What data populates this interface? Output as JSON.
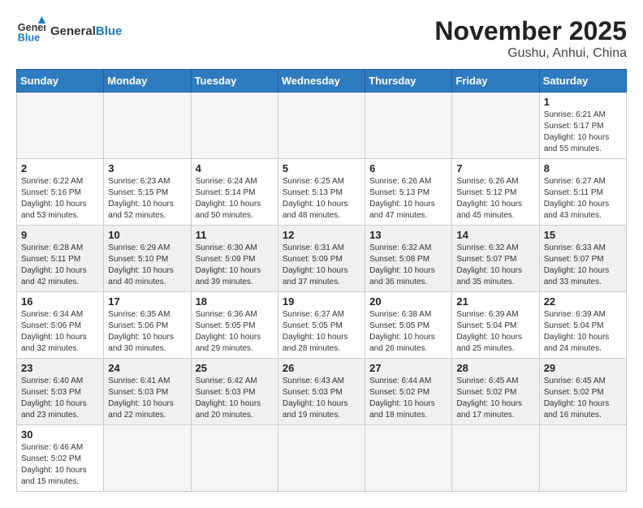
{
  "header": {
    "logo_general": "General",
    "logo_blue": "Blue",
    "month_title": "November 2025",
    "location": "Gushu, Anhui, China"
  },
  "weekdays": [
    "Sunday",
    "Monday",
    "Tuesday",
    "Wednesday",
    "Thursday",
    "Friday",
    "Saturday"
  ],
  "days": {
    "1": {
      "sunrise": "6:21 AM",
      "sunset": "5:17 PM",
      "daylight": "10 hours and 55 minutes."
    },
    "2": {
      "sunrise": "6:22 AM",
      "sunset": "5:16 PM",
      "daylight": "10 hours and 53 minutes."
    },
    "3": {
      "sunrise": "6:23 AM",
      "sunset": "5:15 PM",
      "daylight": "10 hours and 52 minutes."
    },
    "4": {
      "sunrise": "6:24 AM",
      "sunset": "5:14 PM",
      "daylight": "10 hours and 50 minutes."
    },
    "5": {
      "sunrise": "6:25 AM",
      "sunset": "5:13 PM",
      "daylight": "10 hours and 48 minutes."
    },
    "6": {
      "sunrise": "6:26 AM",
      "sunset": "5:13 PM",
      "daylight": "10 hours and 47 minutes."
    },
    "7": {
      "sunrise": "6:26 AM",
      "sunset": "5:12 PM",
      "daylight": "10 hours and 45 minutes."
    },
    "8": {
      "sunrise": "6:27 AM",
      "sunset": "5:11 PM",
      "daylight": "10 hours and 43 minutes."
    },
    "9": {
      "sunrise": "6:28 AM",
      "sunset": "5:11 PM",
      "daylight": "10 hours and 42 minutes."
    },
    "10": {
      "sunrise": "6:29 AM",
      "sunset": "5:10 PM",
      "daylight": "10 hours and 40 minutes."
    },
    "11": {
      "sunrise": "6:30 AM",
      "sunset": "5:09 PM",
      "daylight": "10 hours and 39 minutes."
    },
    "12": {
      "sunrise": "6:31 AM",
      "sunset": "5:09 PM",
      "daylight": "10 hours and 37 minutes."
    },
    "13": {
      "sunrise": "6:32 AM",
      "sunset": "5:08 PM",
      "daylight": "10 hours and 36 minutes."
    },
    "14": {
      "sunrise": "6:32 AM",
      "sunset": "5:07 PM",
      "daylight": "10 hours and 35 minutes."
    },
    "15": {
      "sunrise": "6:33 AM",
      "sunset": "5:07 PM",
      "daylight": "10 hours and 33 minutes."
    },
    "16": {
      "sunrise": "6:34 AM",
      "sunset": "5:06 PM",
      "daylight": "10 hours and 32 minutes."
    },
    "17": {
      "sunrise": "6:35 AM",
      "sunset": "5:06 PM",
      "daylight": "10 hours and 30 minutes."
    },
    "18": {
      "sunrise": "6:36 AM",
      "sunset": "5:05 PM",
      "daylight": "10 hours and 29 minutes."
    },
    "19": {
      "sunrise": "6:37 AM",
      "sunset": "5:05 PM",
      "daylight": "10 hours and 28 minutes."
    },
    "20": {
      "sunrise": "6:38 AM",
      "sunset": "5:05 PM",
      "daylight": "10 hours and 26 minutes."
    },
    "21": {
      "sunrise": "6:39 AM",
      "sunset": "5:04 PM",
      "daylight": "10 hours and 25 minutes."
    },
    "22": {
      "sunrise": "6:39 AM",
      "sunset": "5:04 PM",
      "daylight": "10 hours and 24 minutes."
    },
    "23": {
      "sunrise": "6:40 AM",
      "sunset": "5:03 PM",
      "daylight": "10 hours and 23 minutes."
    },
    "24": {
      "sunrise": "6:41 AM",
      "sunset": "5:03 PM",
      "daylight": "10 hours and 22 minutes."
    },
    "25": {
      "sunrise": "6:42 AM",
      "sunset": "5:03 PM",
      "daylight": "10 hours and 20 minutes."
    },
    "26": {
      "sunrise": "6:43 AM",
      "sunset": "5:03 PM",
      "daylight": "10 hours and 19 minutes."
    },
    "27": {
      "sunrise": "6:44 AM",
      "sunset": "5:02 PM",
      "daylight": "10 hours and 18 minutes."
    },
    "28": {
      "sunrise": "6:45 AM",
      "sunset": "5:02 PM",
      "daylight": "10 hours and 17 minutes."
    },
    "29": {
      "sunrise": "6:45 AM",
      "sunset": "5:02 PM",
      "daylight": "10 hours and 16 minutes."
    },
    "30": {
      "sunrise": "6:46 AM",
      "sunset": "5:02 PM",
      "daylight": "10 hours and 15 minutes."
    }
  },
  "labels": {
    "sunrise": "Sunrise:",
    "sunset": "Sunset:",
    "daylight": "Daylight:"
  }
}
